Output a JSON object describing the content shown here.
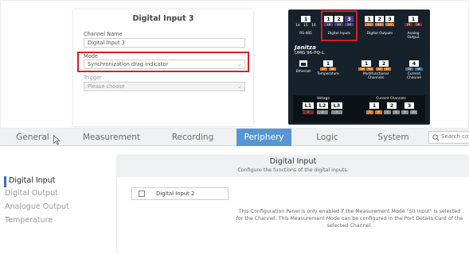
{
  "card": {
    "title": "Digital Input 3",
    "channel_name": {
      "label": "Channel Name",
      "value": "Digital Input 3"
    },
    "mode": {
      "label": "Mode",
      "value": "Synchronization drag indicator"
    },
    "trigger": {
      "label": "Trigger",
      "placeholder": "Please choose"
    }
  },
  "device": {
    "brand": "Janitza",
    "model": "UMG 96-PQ-L",
    "rs485": {
      "num": "1",
      "pins": [
        "14",
        "15",
        "16"
      ],
      "label": "RS-485"
    },
    "digital_inputs": {
      "nums": [
        "1",
        "2",
        "3"
      ],
      "pins": [
        "18",
        "19",
        "20"
      ],
      "label": "Digital Inputs"
    },
    "digital_outputs": {
      "nums": [
        "1",
        "2",
        "3"
      ],
      "pins": [
        "21",
        "22",
        "23"
      ],
      "label": "Digital Outputs"
    },
    "analog_output": {
      "num": "1",
      "pins": [
        "25",
        "26"
      ],
      "label": "Analog Output"
    },
    "ethernet": {
      "label": "Ethernet"
    },
    "temperature": {
      "num": "1",
      "pins": [
        "27",
        "28"
      ],
      "label": "Temperature"
    },
    "multifunctional": {
      "nums": [
        "1",
        "2"
      ],
      "pins": [
        "29",
        "30",
        "31",
        "32"
      ],
      "label": "Multifunctional Channels"
    },
    "current_channel": {
      "num": "4",
      "pins": [
        "35",
        "36"
      ],
      "label": "Current Channel"
    },
    "voltage": {
      "label": "Voltage",
      "nums": [
        "L1",
        "L2",
        "L3"
      ],
      "pins": [
        "1",
        "2",
        "3"
      ]
    },
    "current_channels": {
      "label": "Current Channels",
      "nums": [
        "1",
        "2",
        "3"
      ],
      "pins": [
        "5",
        "6",
        "7",
        "8",
        "9",
        "10"
      ]
    }
  },
  "tabs": [
    {
      "label": "General",
      "active": false
    },
    {
      "label": "Measurement",
      "active": false
    },
    {
      "label": "Recording",
      "active": false
    },
    {
      "label": "Periphery",
      "active": true
    },
    {
      "label": "Logic",
      "active": false
    },
    {
      "label": "System",
      "active": false
    }
  ],
  "search": {
    "text": "Search co"
  },
  "sidebar": {
    "items": [
      {
        "label": "Digital Input",
        "active": true
      },
      {
        "label": "Digital Output",
        "active": false
      },
      {
        "label": "Analogue Output",
        "active": false
      },
      {
        "label": "Temperature",
        "active": false
      }
    ]
  },
  "content": {
    "title": "Digital Input",
    "subtitle": "Configure the functions of the digital inputs.",
    "item": "Digital Input 2",
    "note": "This Configuration Panel is only enabled if the Measurement Mode \"S0 input\" is selected for the Channel. This Measurement Mode can be configured in the Port Details Card of the selected Channel."
  },
  "colors": {
    "highlight": "#d21f2a",
    "active_tab": "#5896d3",
    "device_bg": "#16212b",
    "digital_inputs": "#4f3d7a",
    "digital_outputs": "#d9792a",
    "analog_output": "#7a2a2a"
  }
}
